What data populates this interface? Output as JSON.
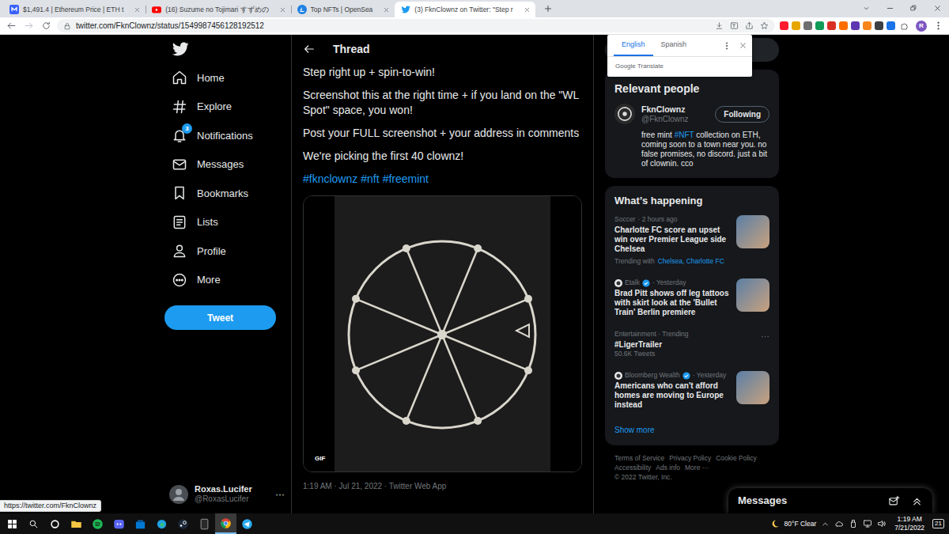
{
  "browser": {
    "tabs": [
      {
        "title": "$1,491.4 | Ethereum Price | ETH t",
        "kind": "coin",
        "selected": false
      },
      {
        "title": "(16) Suzume no Tojimari すずめの",
        "kind": "youtube",
        "selected": false
      },
      {
        "title": "Top NFTs | OpenSea",
        "kind": "opensea",
        "selected": false
      },
      {
        "title": "(3) FknClownz on Twitter: \"Step r",
        "kind": "twitter",
        "selected": true
      }
    ],
    "address": "twitter.com/FknClownz/status/1549987456128192512",
    "profile_initial": "R",
    "status_url": "https://twitter.com/FknClownz"
  },
  "translate_popup": {
    "languages": [
      {
        "label": "English",
        "selected": true
      },
      {
        "label": "Spanish",
        "selected": false
      }
    ],
    "brand": "Google Translate"
  },
  "sidebar": {
    "items": [
      {
        "label": "Home",
        "kind": "home"
      },
      {
        "label": "Explore",
        "kind": "explore"
      },
      {
        "label": "Notifications",
        "kind": "notifications",
        "badge": "3"
      },
      {
        "label": "Messages",
        "kind": "messages"
      },
      {
        "label": "Bookmarks",
        "kind": "bookmarks"
      },
      {
        "label": "Lists",
        "kind": "lists"
      },
      {
        "label": "Profile",
        "kind": "profile"
      },
      {
        "label": "More",
        "kind": "more"
      }
    ],
    "tweet_button": "Tweet",
    "account": {
      "name": "Roxas.Lucifer",
      "handle": "@RoxasLucifer",
      "menu": "···"
    }
  },
  "thread": {
    "header": "Thread",
    "paragraphs": [
      "Step right up + spin-to-win!",
      "Screenshot this at the right time + if you land on the \"WL Spot\" space, you won!",
      "Post your FULL screenshot + your address in comments",
      "We're picking the first 40 clownz!"
    ],
    "hashtags": [
      "#fknclownz",
      "#nft",
      "#freemint"
    ],
    "media_label": "GIF",
    "timestamp": "1:19 AM · Jul 21, 2022 · Twitter Web App"
  },
  "relevant_people": {
    "heading": "Relevant people",
    "people": [
      {
        "name": "FknClownz",
        "handle": "@FknClownz",
        "button": "Following",
        "bio": [
          {
            "text": "free mint ",
            "link": false
          },
          {
            "text": "#NFT",
            "link": true
          },
          {
            "text": " collection on ETH, coming soon to a town near you. no false promises, no discord. just a bit of clownin. cco",
            "link": false
          }
        ]
      }
    ]
  },
  "trends": {
    "heading": "What’s happening",
    "items": [
      {
        "kind": "topic",
        "source": "Soccer",
        "when": "· 2 hours ago",
        "title": "Charlotte FC score an upset win over Premier League side Chelsea",
        "context": "Trending with",
        "context_links": "Chelsea, Charlotte FC"
      },
      {
        "kind": "source",
        "source": "Etalk",
        "when": "· Yesterday",
        "title": "Brad Pitt shows off leg tattoos with skirt look at the 'Bullet Train' Berlin premiere"
      },
      {
        "kind": "trend",
        "source": "Entertainment · Trending",
        "title": "#LigerTrailer",
        "count": "50.6K Tweets",
        "menu": "···"
      },
      {
        "kind": "source",
        "source": "Bloomberg Wealth",
        "when": "· Yesterday",
        "title": "Americans who can't afford homes are moving to Europe instead"
      }
    ],
    "show_more": "Show more"
  },
  "footer": {
    "links": [
      "Terms of Service",
      "Privacy Policy",
      "Cookie Policy",
      "Accessibility",
      "Ads info",
      "More ···"
    ],
    "copyright": "© 2022 Twitter, Inc."
  },
  "messages_drawer": {
    "title": "Messages"
  },
  "taskbar": {
    "apps": [
      {
        "kind": "cortana",
        "active": false
      },
      {
        "kind": "explorer",
        "active": false
      },
      {
        "kind": "spotify",
        "active": false
      },
      {
        "kind": "discord",
        "active": false
      },
      {
        "kind": "store",
        "active": false
      },
      {
        "kind": "edge",
        "active": false
      },
      {
        "kind": "steam",
        "active": false
      },
      {
        "kind": "epic",
        "active": false
      },
      {
        "kind": "chrome",
        "active": true
      },
      {
        "kind": "telegram",
        "active": false
      }
    ],
    "weather": "80°F Clear",
    "time": "1:19 AM",
    "date": "7/21/2022",
    "notifications": "21"
  }
}
